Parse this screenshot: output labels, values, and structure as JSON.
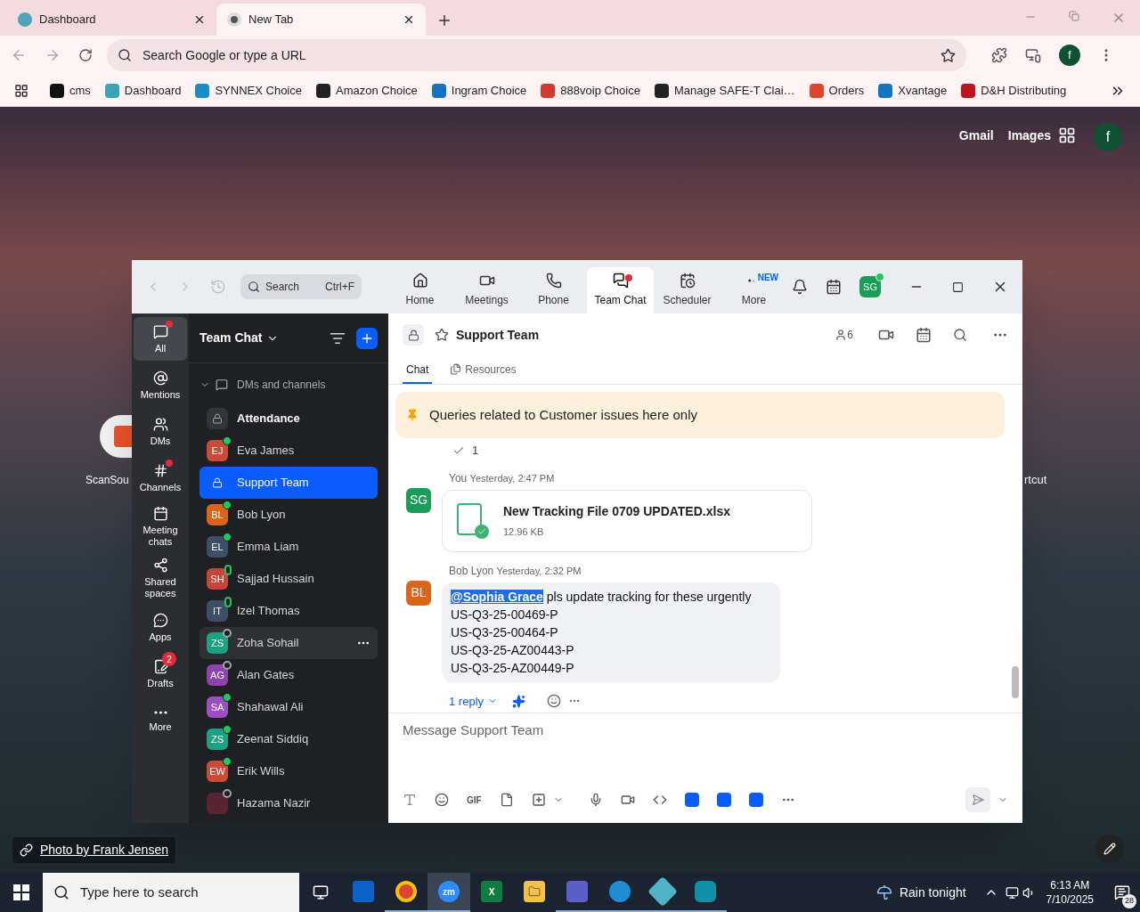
{
  "browser": {
    "tabs": [
      {
        "title": "Dashboard",
        "selected": false
      },
      {
        "title": "New Tab",
        "selected": true
      }
    ],
    "address_placeholder": "Search Google or type a URL",
    "profile_initial": "f",
    "bookmarks": [
      "cms",
      "Dashboard",
      "SYNNEX Choice",
      "Amazon Choice",
      "Ingram Choice",
      "888voip Choice",
      "Manage SAFE-T Clai…",
      "Orders",
      "Xvantage",
      "D&H Distributing"
    ]
  },
  "new_tab": {
    "links": [
      "Gmail",
      "Images"
    ],
    "profile_initial": "f",
    "shortcuts": [
      "ScanSou",
      "rtcut"
    ],
    "photo_credit": "Photo by Frank Jensen"
  },
  "zoom": {
    "search": {
      "placeholder": "Search",
      "shortcut": "Ctrl+F"
    },
    "nav_tabs": [
      {
        "label": "Home",
        "selected": false,
        "dot": false
      },
      {
        "label": "Meetings",
        "selected": false,
        "dot": false
      },
      {
        "label": "Phone",
        "selected": false,
        "dot": false
      },
      {
        "label": "Team Chat",
        "selected": true,
        "dot": true
      },
      {
        "label": "Scheduler",
        "selected": false,
        "dot": false
      },
      {
        "label": "More",
        "selected": false,
        "dot": false,
        "badge": "NEW"
      }
    ],
    "user_initials": "SG",
    "rail": [
      {
        "label": "All",
        "selected": true,
        "dot": true
      },
      {
        "label": "Mentions",
        "selected": false,
        "dot": false
      },
      {
        "label": "DMs",
        "selected": false,
        "dot": false
      },
      {
        "label": "Channels",
        "selected": false,
        "dot": true
      },
      {
        "label": "Meeting chats",
        "selected": false,
        "dot": false
      },
      {
        "label": "Shared spaces",
        "selected": false,
        "dot": false
      },
      {
        "label": "Apps",
        "selected": false,
        "dot": false
      },
      {
        "label": "Drafts",
        "selected": false,
        "dot": false,
        "badge": "2"
      },
      {
        "label": "More",
        "selected": false,
        "dot": false
      }
    ],
    "chat_list": {
      "title": "Team Chat",
      "section": "DMs and channels",
      "expanded": true,
      "items": [
        {
          "kind": "channel",
          "name": "Attendance",
          "selected": false,
          "unread": true,
          "hovered": false
        },
        {
          "kind": "dm",
          "name": "Eva James",
          "initials": "EJ",
          "color": "#c94a36",
          "online": true,
          "mobile": false,
          "selected": false,
          "unread": false,
          "hovered": false
        },
        {
          "kind": "channel",
          "name": "Support Team",
          "selected": true,
          "unread": false,
          "hovered": false
        },
        {
          "kind": "dm",
          "name": "Bob Lyon",
          "initials": "BL",
          "color": "#d9651b",
          "online": true,
          "mobile": false,
          "selected": false,
          "unread": false,
          "hovered": false
        },
        {
          "kind": "dm",
          "name": "Emma Liam",
          "initials": "EL",
          "color": "#3d4f66",
          "online": true,
          "mobile": false,
          "selected": false,
          "unread": false,
          "hovered": false
        },
        {
          "kind": "dm",
          "name": "Sajjad Hussain",
          "initials": "SH",
          "color": "#c7443a",
          "online": true,
          "mobile": true,
          "selected": false,
          "unread": false,
          "hovered": false
        },
        {
          "kind": "dm",
          "name": "Izel Thomas",
          "initials": "IT",
          "color": "#3d4f66",
          "online": true,
          "mobile": true,
          "selected": false,
          "unread": false,
          "hovered": false
        },
        {
          "kind": "dm",
          "name": "Zoha Sohail",
          "initials": "ZS",
          "color": "#1fa082",
          "online": false,
          "mobile": false,
          "selected": false,
          "unread": false,
          "hovered": true
        },
        {
          "kind": "dm",
          "name": "Alan Gates",
          "initials": "AG",
          "color": "#8e44ad",
          "online": false,
          "mobile": false,
          "selected": false,
          "unread": false,
          "hovered": false
        },
        {
          "kind": "dm",
          "name": "Shahawal Ali",
          "initials": "SA",
          "color": "#9b4fc0",
          "online": true,
          "mobile": false,
          "selected": false,
          "unread": false,
          "hovered": false
        },
        {
          "kind": "dm",
          "name": "Zeenat Siddiq",
          "initials": "ZS",
          "color": "#1fa082",
          "online": true,
          "mobile": false,
          "selected": false,
          "unread": false,
          "hovered": false
        },
        {
          "kind": "dm",
          "name": "Erik Wills",
          "initials": "EW",
          "color": "#c94a36",
          "online": true,
          "mobile": false,
          "selected": false,
          "unread": false,
          "hovered": false
        },
        {
          "kind": "dm",
          "name": "Hazama Nazir",
          "color": "#5a2430",
          "online": false,
          "mobile": false,
          "selected": false,
          "unread": false,
          "hovered": false
        }
      ]
    },
    "channel": {
      "name": "Support Team",
      "member_count": "6",
      "tabs": [
        {
          "label": "Chat",
          "selected": true
        },
        {
          "label": "Resources",
          "selected": false
        }
      ],
      "pinned": "Queries related to Customer issues here only",
      "read_count": "1",
      "messages": [
        {
          "kind": "file",
          "sender": "You",
          "time": "Yesterday, 2:47 PM",
          "initials": "SG",
          "color": "#1a9e57",
          "file_name": "New Tracking File 0709 UPDATED.xlsx",
          "file_size": "12.96 KB"
        },
        {
          "kind": "text",
          "sender": "Bob Lyon",
          "time": "Yesterday, 2:32 PM",
          "initials": "BL",
          "color": "#d9651b",
          "mention": "@Sophia Grace",
          "mention_selected": true,
          "lines": [
            "pls update tracking for these urgently",
            "US-Q3-25-00469-P",
            "US-Q3-25-00464-P",
            "US-Q3-25-AZ00443-P",
            "US-Q3-25-AZ00449-P"
          ],
          "reply_count": "1 reply"
        }
      ],
      "compose_placeholder": "Message Support Team",
      "gif_label": "GIF"
    }
  },
  "taskbar": {
    "search_placeholder": "Type here to search",
    "apps": [
      {
        "kind": "outlook",
        "running": false,
        "selected": false
      },
      {
        "kind": "chrome",
        "running": true,
        "selected": false
      },
      {
        "kind": "zoom",
        "running": true,
        "selected": true,
        "label": "zm"
      },
      {
        "kind": "excel",
        "running": false,
        "selected": false,
        "label": "X"
      },
      {
        "kind": "explorer",
        "running": false,
        "selected": false
      },
      {
        "kind": "teams",
        "running": true,
        "selected": false
      },
      {
        "kind": "edge",
        "running": true,
        "selected": false
      },
      {
        "kind": "diamond",
        "running": true,
        "selected": false
      },
      {
        "kind": "s",
        "running": true,
        "selected": false
      }
    ],
    "weather": "Rain tonight",
    "time": "6:13 AM",
    "date": "7/10/2025",
    "notifications": "28"
  }
}
